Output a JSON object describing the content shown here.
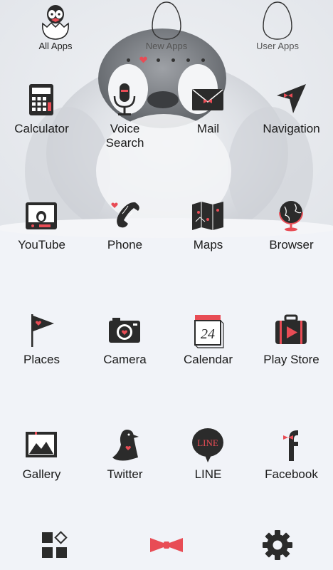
{
  "tabs": [
    {
      "label": "All Apps",
      "icon": "penguin-egg-icon"
    },
    {
      "label": "New Apps",
      "icon": "egg-outline-icon"
    },
    {
      "label": "User Apps",
      "icon": "egg-outline-icon"
    }
  ],
  "apps": [
    {
      "label": "Calculator",
      "icon": "calculator-icon"
    },
    {
      "label": "Voice\nSearch",
      "icon": "microphone-icon"
    },
    {
      "label": "Mail",
      "icon": "envelope-icon"
    },
    {
      "label": "Navigation",
      "icon": "navigation-arrow-icon"
    },
    {
      "label": "YouTube",
      "icon": "tv-icon"
    },
    {
      "label": "Phone",
      "icon": "phone-icon"
    },
    {
      "label": "Maps",
      "icon": "map-icon"
    },
    {
      "label": "Browser",
      "icon": "globe-icon"
    },
    {
      "label": "Places",
      "icon": "flag-icon"
    },
    {
      "label": "Camera",
      "icon": "camera-icon"
    },
    {
      "label": "Calendar",
      "icon": "calendar-icon"
    },
    {
      "label": "Play Store",
      "icon": "suitcase-play-icon"
    },
    {
      "label": "Gallery",
      "icon": "picture-frame-icon"
    },
    {
      "label": "Twitter",
      "icon": "penguin-icon"
    },
    {
      "label": "LINE",
      "icon": "speech-bubble-icon"
    },
    {
      "label": "Facebook",
      "icon": "facebook-f-icon"
    }
  ],
  "calendar_day": "24",
  "line_logo_text": "LINE",
  "dock": [
    {
      "icon": "app-grid-icon"
    },
    {
      "icon": "bow-tie-icon"
    },
    {
      "icon": "settings-gear-icon"
    }
  ],
  "colors": {
    "accent_red": "#e84c55",
    "icon_dark": "#2b2b2b",
    "background": "#f1f3f8"
  }
}
